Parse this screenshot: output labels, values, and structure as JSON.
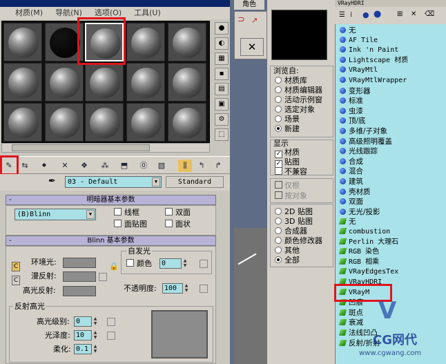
{
  "material_editor": {
    "menu": [
      "材质(M)",
      "导航(N)",
      "选项(O)",
      "工具(U)"
    ],
    "material_name": "03 - Default",
    "material_type": "Standard",
    "shader_rollout": {
      "title": "明暗器基本参数",
      "shader": "(B)Blinn",
      "wire": "线框",
      "two_sided": "双面",
      "face_map": "面贴图",
      "faceted": "面状"
    },
    "blinn_rollout": {
      "title": "Blinn 基本参数",
      "ambient": "环境光:",
      "diffuse": "漫反射:",
      "specular": "高光反射:",
      "self_illum_group": "自发光",
      "color": "颜色",
      "self_illum_value": "0",
      "opacity": "不透明度:",
      "opacity_value": "100",
      "specular_group": "反射高光",
      "spec_level": "高光级别:",
      "spec_level_value": "0",
      "glossiness": "光泽度:",
      "glossiness_value": "10",
      "soften": "柔化:",
      "soften_value": "0.1",
      "c_btn": "C"
    },
    "rollout_sign": "-"
  },
  "middle": {
    "tab": "角色"
  },
  "browser": {
    "title": "VRayHDRI",
    "browse_from": {
      "label": "浏览自:",
      "options": [
        "材质库",
        "材质编辑器",
        "活动示例窗",
        "选定对象",
        "场景",
        "新建"
      ],
      "selected": 5
    },
    "show": {
      "label": "显示",
      "options": [
        "材质",
        "贴图",
        "不兼容"
      ],
      "checked": [
        true,
        true,
        false
      ]
    },
    "disabled": [
      "仅根",
      "按对象"
    ],
    "filters": {
      "options": [
        "2D 贴图",
        "3D 贴图",
        "合成器",
        "颜色修改器",
        "其他",
        "全部"
      ],
      "selected": 5
    },
    "items": [
      {
        "label": "无",
        "type": "mat"
      },
      {
        "label": "AF Tile",
        "type": "mat"
      },
      {
        "label": "Ink 'n Paint",
        "type": "mat"
      },
      {
        "label": "Lightscape 材质",
        "type": "mat"
      },
      {
        "label": "VRayMtl",
        "type": "mat"
      },
      {
        "label": "VRayMtlWrapper",
        "type": "mat"
      },
      {
        "label": "变形器",
        "type": "mat"
      },
      {
        "label": "标准",
        "type": "mat"
      },
      {
        "label": "虫漆",
        "type": "mat"
      },
      {
        "label": "顶/底",
        "type": "mat"
      },
      {
        "label": "多维/子对象",
        "type": "mat"
      },
      {
        "label": "高级照明覆盖",
        "type": "mat"
      },
      {
        "label": "光线跟踪",
        "type": "mat"
      },
      {
        "label": "合成",
        "type": "mat"
      },
      {
        "label": "混合",
        "type": "mat"
      },
      {
        "label": "建筑",
        "type": "mat"
      },
      {
        "label": "壳材质",
        "type": "mat"
      },
      {
        "label": "双面",
        "type": "mat"
      },
      {
        "label": "无光/投影",
        "type": "mat"
      },
      {
        "label": "无",
        "type": "map"
      },
      {
        "label": "combustion",
        "type": "map"
      },
      {
        "label": "Perlin 大理石",
        "type": "map"
      },
      {
        "label": "RGB 染色",
        "type": "map"
      },
      {
        "label": "RGB 相乘",
        "type": "map"
      },
      {
        "label": "VRayEdgesTex",
        "type": "map"
      },
      {
        "label": "VRayHDRI",
        "type": "map"
      },
      {
        "label": "VRayM",
        "type": "map"
      },
      {
        "label": "凹痕",
        "type": "map"
      },
      {
        "label": "斑点",
        "type": "map"
      },
      {
        "label": "衰减",
        "type": "map"
      },
      {
        "label": "法线凹凸",
        "type": "map"
      },
      {
        "label": "反射/折射",
        "type": "map"
      }
    ]
  },
  "watermark": {
    "brand": "CG网代",
    "url": "www.cgwang.com"
  }
}
